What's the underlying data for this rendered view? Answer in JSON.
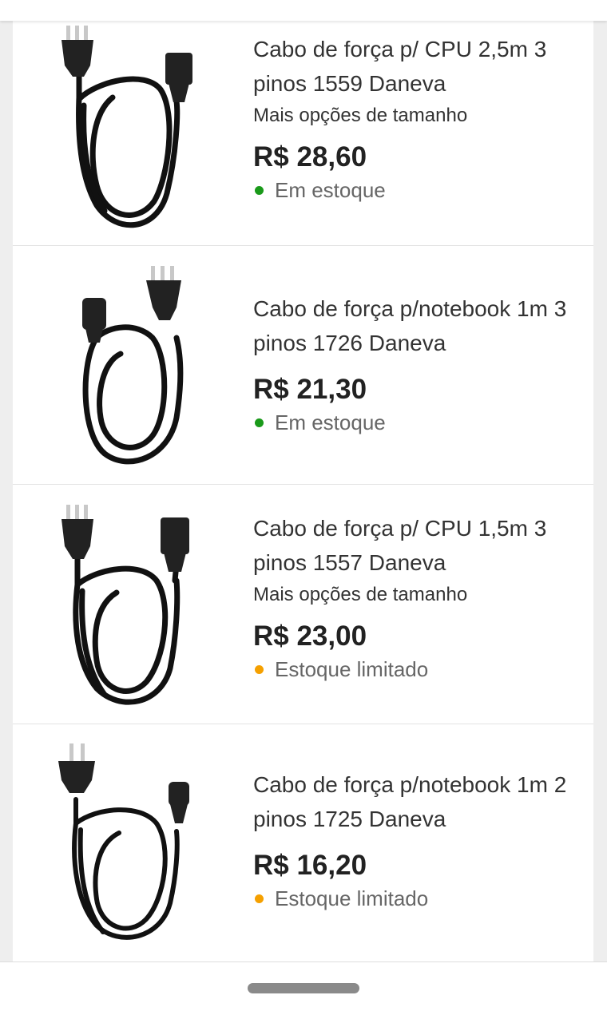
{
  "colors": {
    "in_stock": "#1a9a1a",
    "limited_stock": "#f5a000",
    "price": "#222222",
    "text": "#333333"
  },
  "products": [
    {
      "title": "Cabo de força p/ CPU 2,5m 3 pinos 1559 Daneva",
      "sizes": "Mais opções de tamanho",
      "price": "R$ 28,60",
      "stock": "Em estoque",
      "stock_status": "in_stock",
      "image": "power-cable-3-pin-cpu-icon"
    },
    {
      "title": "Cabo de força p/notebook 1m 3 pinos 1726 Daneva",
      "price": "R$ 21,30",
      "stock": "Em estoque",
      "stock_status": "in_stock",
      "image": "power-cable-3-pin-notebook-icon"
    },
    {
      "title": "Cabo de força p/ CPU 1,5m 3 pinos 1557 Daneva",
      "sizes": "Mais opções de tamanho",
      "price": "R$ 23,00",
      "stock": "Estoque limitado",
      "stock_status": "limited",
      "image": "power-cable-3-pin-cpu-icon"
    },
    {
      "title": "Cabo de força p/notebook 1m 2 pinos 1725 Daneva",
      "price": "R$ 16,20",
      "stock": "Estoque limitado",
      "stock_status": "limited",
      "image": "power-cable-2-pin-notebook-icon"
    }
  ]
}
